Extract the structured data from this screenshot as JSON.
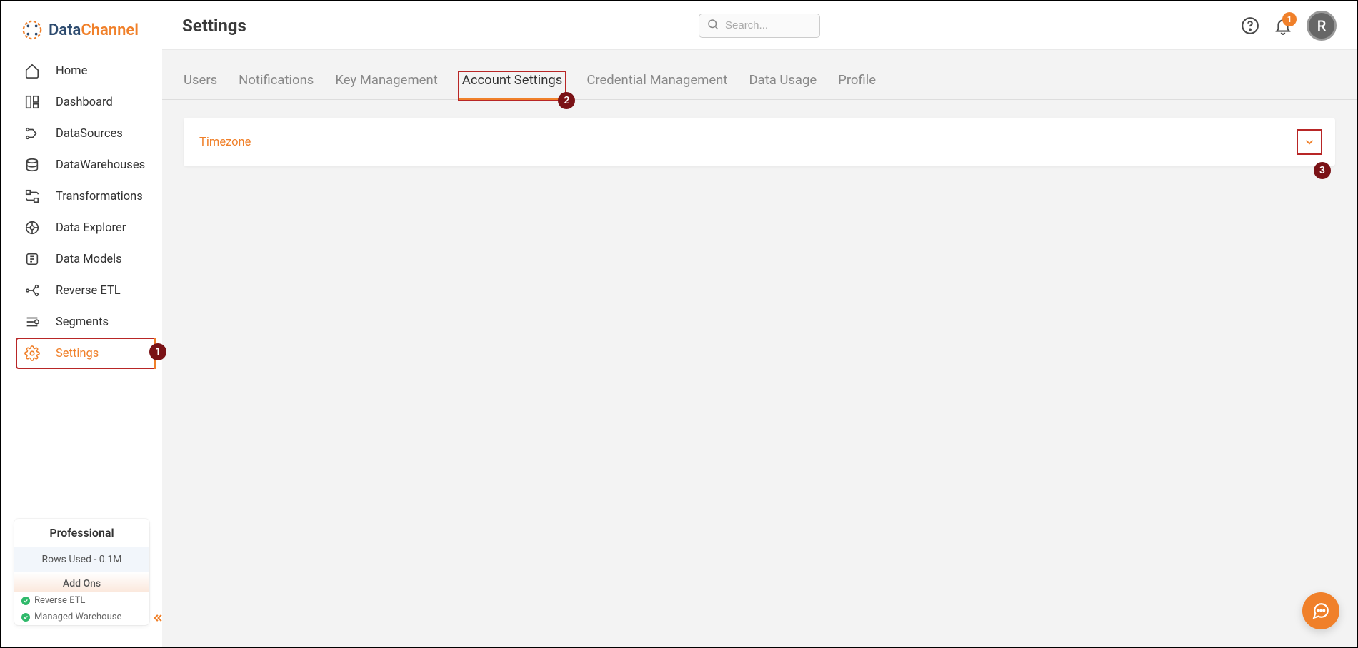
{
  "brand": {
    "part1": "Data",
    "part2": "Channel"
  },
  "sidebar": {
    "items": [
      {
        "label": "Home"
      },
      {
        "label": "Dashboard"
      },
      {
        "label": "DataSources"
      },
      {
        "label": "DataWarehouses"
      },
      {
        "label": "Transformations"
      },
      {
        "label": "Data Explorer"
      },
      {
        "label": "Data Models"
      },
      {
        "label": "Reverse ETL"
      },
      {
        "label": "Segments"
      },
      {
        "label": "Settings"
      }
    ]
  },
  "plan": {
    "title": "Professional",
    "rows_used": "Rows Used - 0.1M",
    "addons_title": "Add Ons",
    "addons": [
      {
        "label": "Reverse ETL"
      },
      {
        "label": "Managed Warehouse"
      }
    ]
  },
  "header": {
    "title": "Settings",
    "search_placeholder": "Search..."
  },
  "notifications": {
    "count": "1"
  },
  "avatar": {
    "initial": "R"
  },
  "tabs": [
    {
      "label": "Users"
    },
    {
      "label": "Notifications"
    },
    {
      "label": "Key Management"
    },
    {
      "label": "Account Settings"
    },
    {
      "label": "Credential Management"
    },
    {
      "label": "Data Usage"
    },
    {
      "label": "Profile"
    }
  ],
  "accordion": {
    "title": "Timezone"
  },
  "callouts": {
    "c1": "1",
    "c2": "2",
    "c3": "3"
  }
}
